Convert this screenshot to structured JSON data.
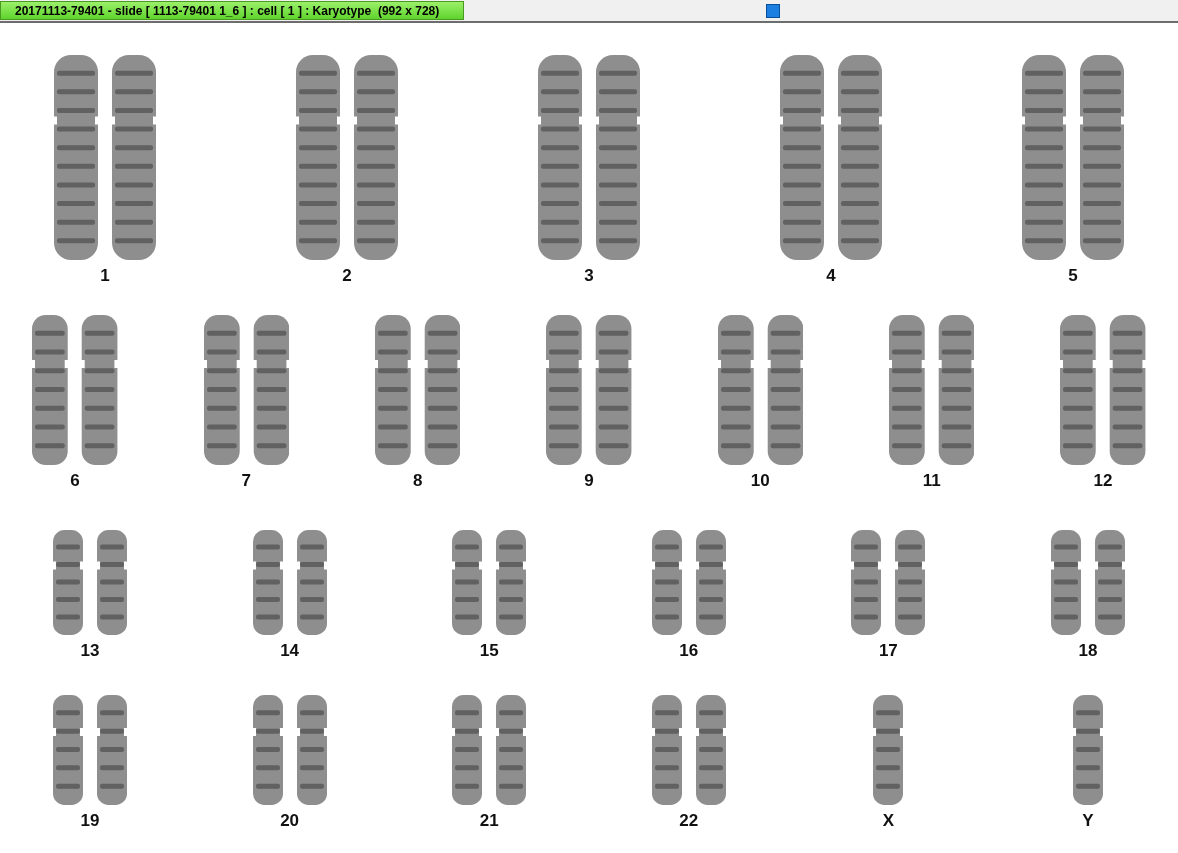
{
  "title_tab": {
    "text": "20171113-79401 - slide [ 1113-79401 1_6 ] : cell [ 1 ] : Karyotype  (992 x 728)"
  },
  "rows": [
    {
      "items": [
        {
          "label": "1",
          "kind": "pair"
        },
        {
          "label": "2",
          "kind": "pair"
        },
        {
          "label": "3",
          "kind": "pair"
        },
        {
          "label": "4",
          "kind": "pair"
        },
        {
          "label": "5",
          "kind": "pair"
        }
      ]
    },
    {
      "items": [
        {
          "label": "6",
          "kind": "pair"
        },
        {
          "label": "7",
          "kind": "pair"
        },
        {
          "label": "8",
          "kind": "pair"
        },
        {
          "label": "9",
          "kind": "pair"
        },
        {
          "label": "10",
          "kind": "pair"
        },
        {
          "label": "11",
          "kind": "pair"
        },
        {
          "label": "12",
          "kind": "pair"
        }
      ]
    },
    {
      "items": [
        {
          "label": "13",
          "kind": "pair"
        },
        {
          "label": "14",
          "kind": "pair"
        },
        {
          "label": "15",
          "kind": "pair"
        },
        {
          "label": "16",
          "kind": "pair"
        },
        {
          "label": "17",
          "kind": "pair"
        },
        {
          "label": "18",
          "kind": "pair"
        }
      ]
    },
    {
      "items": [
        {
          "label": "19",
          "kind": "pair"
        },
        {
          "label": "20",
          "kind": "pair"
        },
        {
          "label": "21",
          "kind": "pair"
        },
        {
          "label": "22",
          "kind": "pair"
        },
        {
          "label": "X",
          "kind": "single"
        },
        {
          "label": "Y",
          "kind": "single"
        }
      ]
    }
  ]
}
